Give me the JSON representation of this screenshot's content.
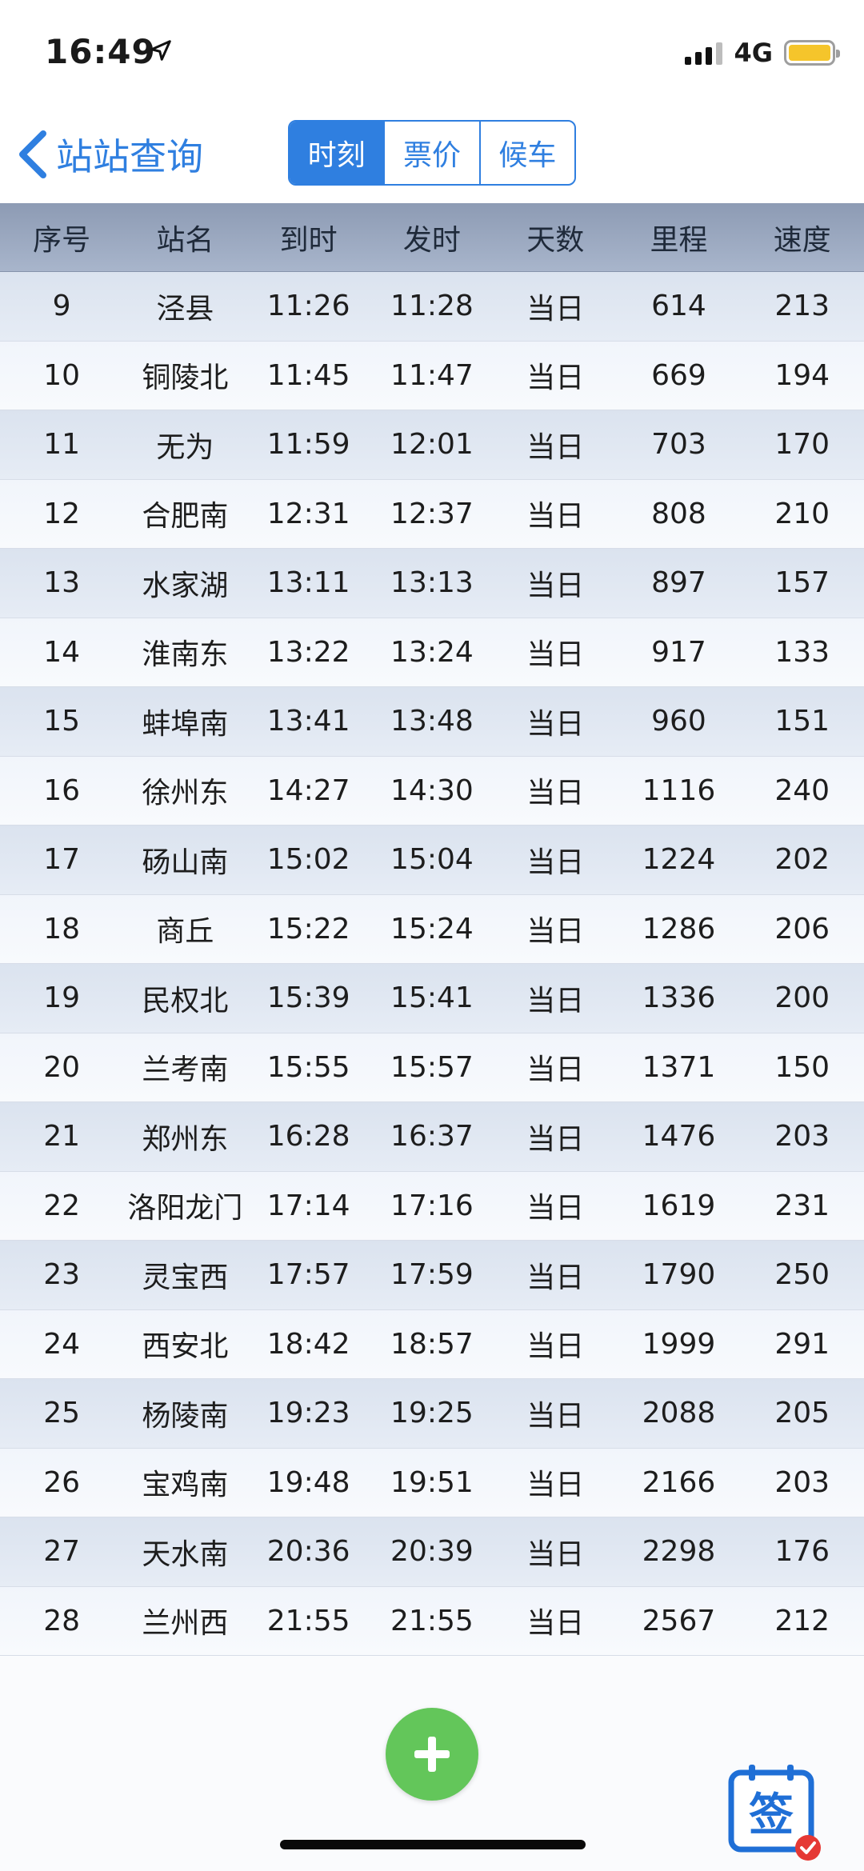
{
  "status": {
    "time": "16:49",
    "network": "4G"
  },
  "nav": {
    "back_label": "站站查询",
    "tabs": [
      {
        "label": "时刻",
        "active": true
      },
      {
        "label": "票价",
        "active": false
      },
      {
        "label": "候车",
        "active": false
      }
    ]
  },
  "table": {
    "columns": [
      "序号",
      "站名",
      "到时",
      "发时",
      "天数",
      "里程",
      "速度"
    ],
    "rows": [
      [
        "9",
        "泾县",
        "11:26",
        "11:28",
        "当日",
        "614",
        "213"
      ],
      [
        "10",
        "铜陵北",
        "11:45",
        "11:47",
        "当日",
        "669",
        "194"
      ],
      [
        "11",
        "无为",
        "11:59",
        "12:01",
        "当日",
        "703",
        "170"
      ],
      [
        "12",
        "合肥南",
        "12:31",
        "12:37",
        "当日",
        "808",
        "210"
      ],
      [
        "13",
        "水家湖",
        "13:11",
        "13:13",
        "当日",
        "897",
        "157"
      ],
      [
        "14",
        "淮南东",
        "13:22",
        "13:24",
        "当日",
        "917",
        "133"
      ],
      [
        "15",
        "蚌埠南",
        "13:41",
        "13:48",
        "当日",
        "960",
        "151"
      ],
      [
        "16",
        "徐州东",
        "14:27",
        "14:30",
        "当日",
        "1116",
        "240"
      ],
      [
        "17",
        "砀山南",
        "15:02",
        "15:04",
        "当日",
        "1224",
        "202"
      ],
      [
        "18",
        "商丘",
        "15:22",
        "15:24",
        "当日",
        "1286",
        "206"
      ],
      [
        "19",
        "民权北",
        "15:39",
        "15:41",
        "当日",
        "1336",
        "200"
      ],
      [
        "20",
        "兰考南",
        "15:55",
        "15:57",
        "当日",
        "1371",
        "150"
      ],
      [
        "21",
        "郑州东",
        "16:28",
        "16:37",
        "当日",
        "1476",
        "203"
      ],
      [
        "22",
        "洛阳龙门",
        "17:14",
        "17:16",
        "当日",
        "1619",
        "231"
      ],
      [
        "23",
        "灵宝西",
        "17:57",
        "17:59",
        "当日",
        "1790",
        "250"
      ],
      [
        "24",
        "西安北",
        "18:42",
        "18:57",
        "当日",
        "1999",
        "291"
      ],
      [
        "25",
        "杨陵南",
        "19:23",
        "19:25",
        "当日",
        "2088",
        "205"
      ],
      [
        "26",
        "宝鸡南",
        "19:48",
        "19:51",
        "当日",
        "2166",
        "203"
      ],
      [
        "27",
        "天水南",
        "20:36",
        "20:39",
        "当日",
        "2298",
        "176"
      ],
      [
        "28",
        "兰州西",
        "21:55",
        "21:55",
        "当日",
        "2567",
        "212"
      ]
    ]
  },
  "sign_button": {
    "label": "签"
  },
  "colors": {
    "accent": "#2f7fe0",
    "add_button": "#63c65a",
    "check_badge": "#e53935"
  }
}
